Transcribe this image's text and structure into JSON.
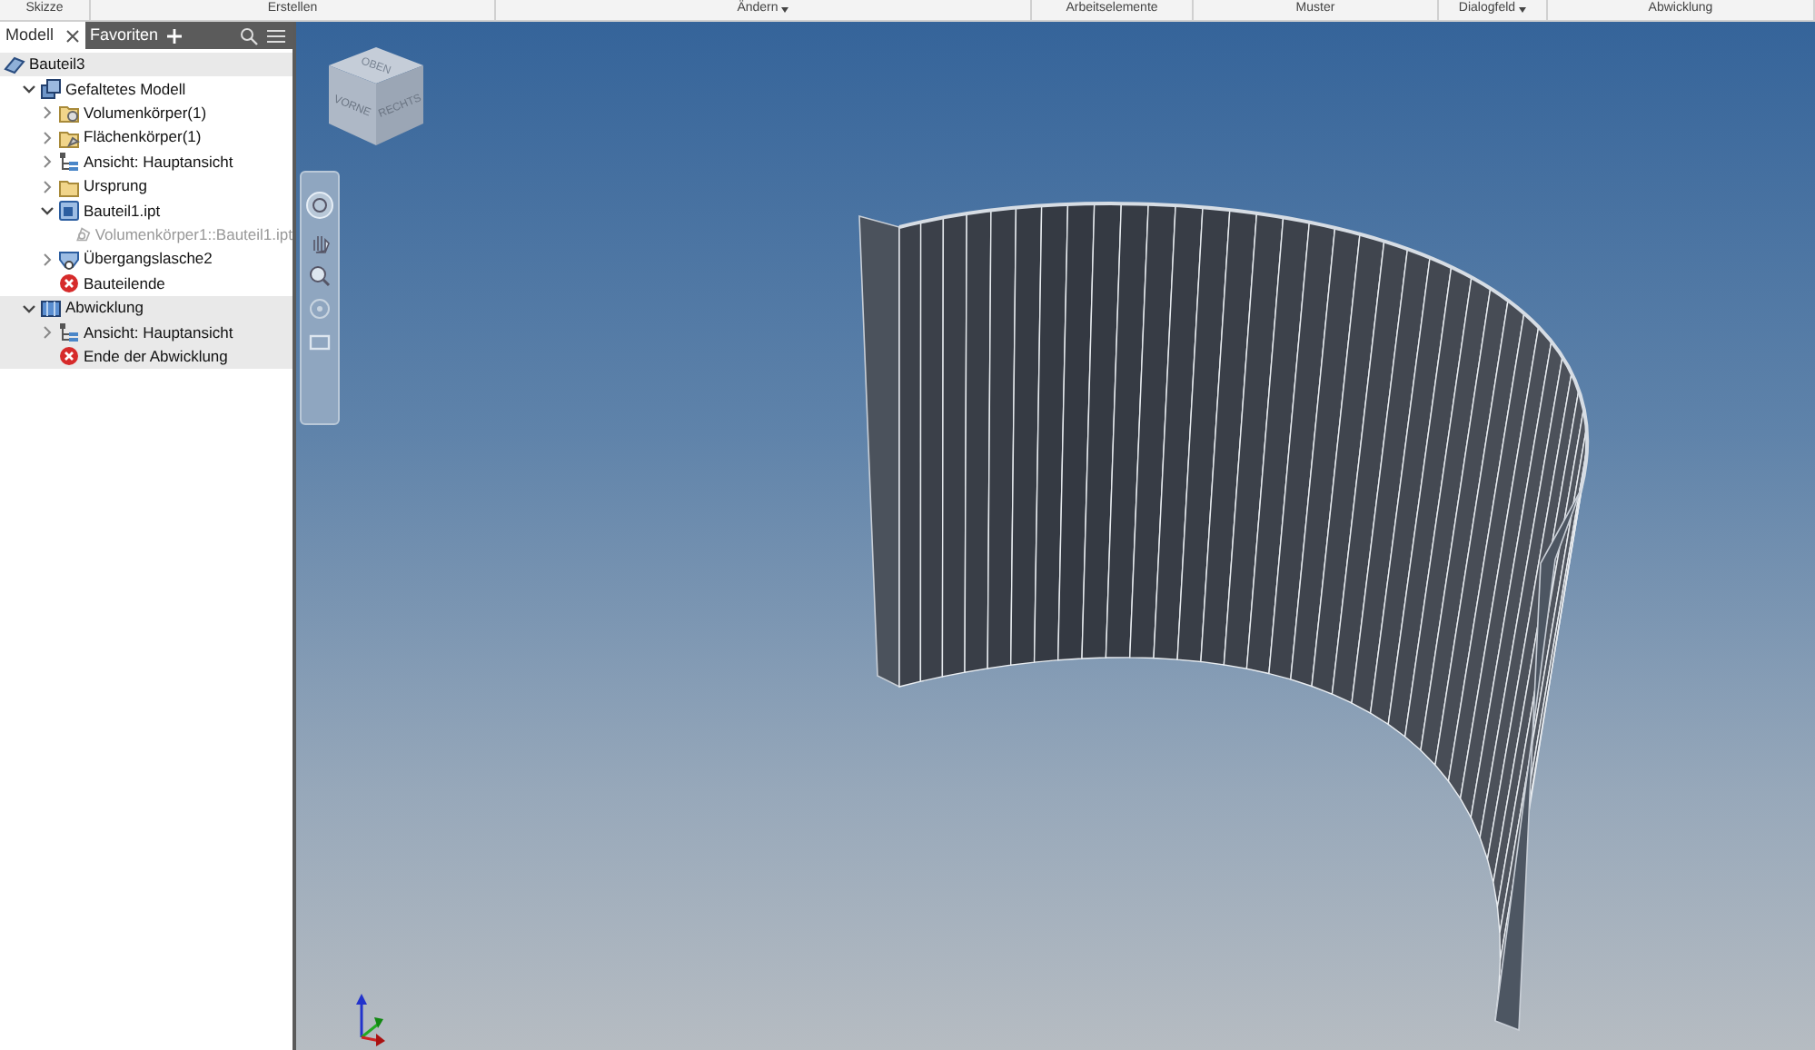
{
  "ribbon_panels": [
    {
      "label": "Skizze",
      "dropdown": false
    },
    {
      "label": "Erstellen",
      "dropdown": false
    },
    {
      "label": "Ändern",
      "dropdown": true
    },
    {
      "label": "Arbeitselemente",
      "dropdown": false
    },
    {
      "label": "Muster",
      "dropdown": false
    },
    {
      "label": "Dialogfeld",
      "dropdown": true
    },
    {
      "label": "Abwicklung",
      "dropdown": false
    }
  ],
  "browser": {
    "tabs": [
      {
        "label": "Modell",
        "selected": true,
        "closable": true
      },
      {
        "label": "Favoriten",
        "selected": false,
        "closable": false
      }
    ],
    "tree": [
      {
        "label": "Bauteil3",
        "kind": "part",
        "shaded": true,
        "children": [
          {
            "label": "Gefaltetes Modell",
            "kind": "model",
            "shaded": false,
            "expanded": true,
            "children": [
              {
                "label": "Volumenkörper(1)",
                "kind": "solids",
                "shaded": false,
                "expanded": false
              },
              {
                "label": "Flächenkörper(1)",
                "kind": "surfaces",
                "shaded": false,
                "expanded": false
              },
              {
                "label": "Ansicht: Hauptansicht",
                "kind": "view",
                "shaded": false,
                "expanded": false
              },
              {
                "label": "Ursprung",
                "kind": "folder",
                "shaded": false,
                "expanded": false
              },
              {
                "label": "Bauteil1.ipt",
                "kind": "ipt",
                "shaded": false,
                "expanded": true,
                "children": [
                  {
                    "label": "Volumenkörper1::Bauteil1.ipt",
                    "kind": "body",
                    "shaded": false,
                    "disabled": true
                  }
                ]
              },
              {
                "label": "Übergangslasche2",
                "kind": "flange",
                "shaded": false,
                "expanded": false
              },
              {
                "label": "Bauteilende",
                "kind": "end",
                "shaded": false
              }
            ]
          },
          {
            "label": "Abwicklung",
            "kind": "flat",
            "shaded": true,
            "expanded": true,
            "children": [
              {
                "label": "Ansicht: Hauptansicht",
                "kind": "view",
                "shaded": true,
                "expanded": false
              },
              {
                "label": "Ende der Abwicklung",
                "kind": "end",
                "shaded": true
              }
            ]
          }
        ]
      }
    ]
  },
  "viewcube": {
    "faces": [
      "OBEN",
      "VORNE",
      "RECHTS"
    ]
  }
}
